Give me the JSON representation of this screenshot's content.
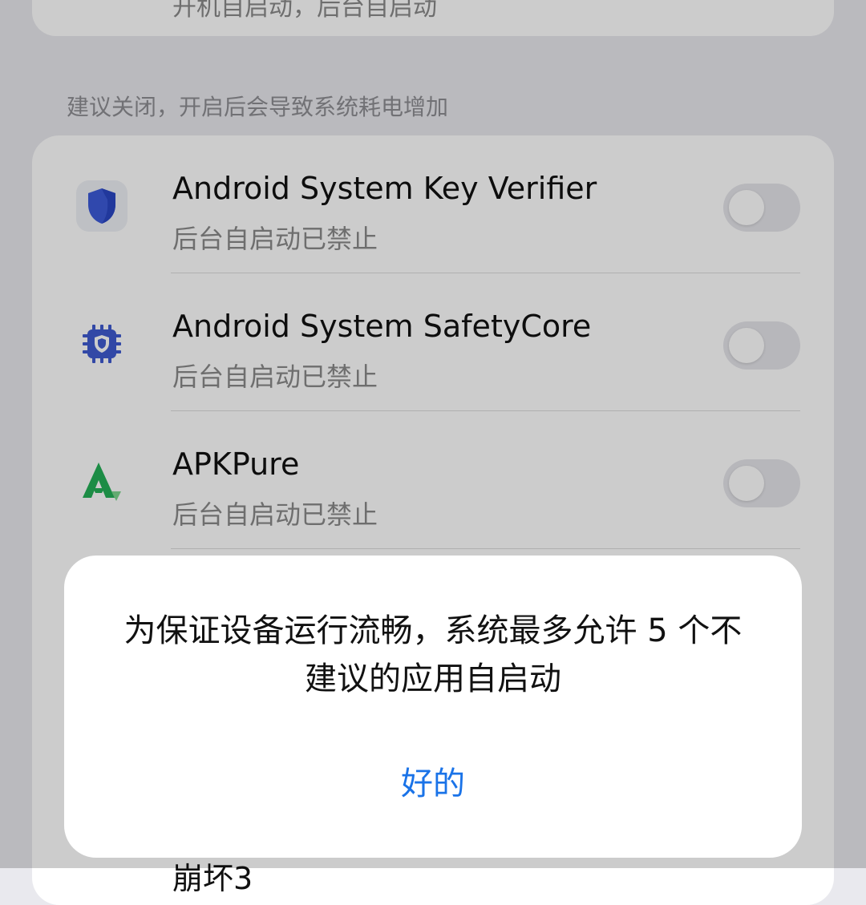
{
  "top_card": {
    "partial_text": "开机自启动，后台自启动"
  },
  "section": {
    "header": "建议关闭，开启后会导致系统耗电增加"
  },
  "apps": [
    {
      "name": "Android System Key Verifier",
      "status": "后台自启动已禁止",
      "icon": "shield-icon",
      "enabled": false
    },
    {
      "name": "Android System SafetyCore",
      "status": "后台自启动已禁止",
      "icon": "chip-shield-icon",
      "enabled": false
    },
    {
      "name": "APKPure",
      "status": "后台自启动已禁止",
      "icon": "apkpure-logo-icon",
      "enabled": false
    },
    {
      "name": "崩坏3",
      "status": "",
      "icon": "",
      "enabled": false
    }
  ],
  "dialog": {
    "message": "为保证设备运行流畅，系统最多允许 5 个不建议的应用自启动",
    "confirm_label": "好的"
  },
  "colors": {
    "accent": "#1a73e8",
    "toggle_off": "#e5e5ea",
    "background": "#e9e9ee",
    "card": "#ffffff",
    "dim_overlay": "rgba(0,0,0,0.2)"
  }
}
